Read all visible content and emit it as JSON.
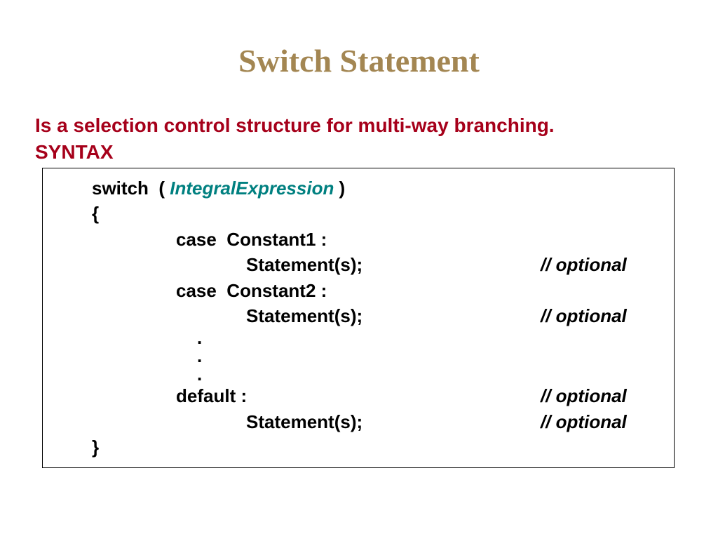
{
  "title": "Switch Statement",
  "subtitle": "Is a selection control structure for multi-way branching.",
  "syntax_label": "SYNTAX",
  "code": {
    "switch_kw": "switch  ( ",
    "switch_expr": "IntegralExpression",
    "switch_close": " )",
    "open_brace": "{",
    "case1": "case  Constant1 :",
    "stmt": "Statement(s);",
    "optional": "// optional",
    "case2": "case  Constant2 :",
    "dot": ".",
    "default": "default :",
    "close_brace": "}"
  }
}
